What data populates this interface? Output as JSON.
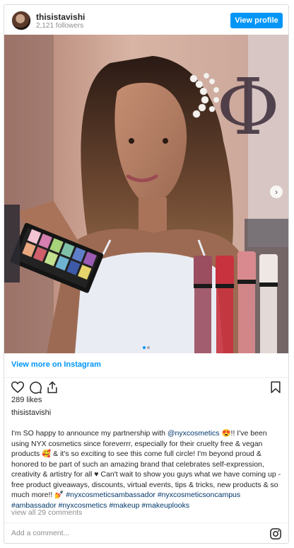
{
  "header": {
    "username": "thisistavishi",
    "followers": "2,121 followers",
    "view_profile_label": "View profile"
  },
  "media": {
    "next_arrow_glyph": "›",
    "carousel_dots": 2,
    "active_dot": 0,
    "dot_active_color": "#0095f6",
    "dot_inactive_color": "#a8a8a8",
    "palette_colors": [
      "#f4c4d3",
      "#d57fb0",
      "#a7d37a",
      "#7fc1a8",
      "#5f7fc8",
      "#9a5cb5",
      "#e8a77e",
      "#cf5f6b",
      "#c3e08e",
      "#6fb3d2",
      "#3d5aa8",
      "#e7d46a"
    ],
    "lip_products": [
      {
        "color": "#9a4e60",
        "name": "lip-gloss-mauve"
      },
      {
        "color": "#c8323e",
        "name": "lip-gloss-red-leopard"
      },
      {
        "color": "#d98a8e",
        "name": "butter-gloss-pink"
      },
      {
        "color": "#efe7e3",
        "name": "filler-lip-leopard"
      }
    ]
  },
  "view_more_label": "View more on Instagram",
  "actions": {
    "like_icon": "heart-icon",
    "comment_icon": "comment-icon",
    "share_icon": "share-icon",
    "save_icon": "bookmark-icon"
  },
  "likes": "289 likes",
  "caption": {
    "author": "thisistavishi",
    "text_1": "I'm SO happy to announce my partnership with ",
    "mention": "@nyxcosmetics",
    "text_2": " 😍!! I've been using NYX cosmetics since foreverrr, especially for their cruelty free & vegan products 🥰 & it's so exciting to see this come full circle! I'm beyond proud & honored to be part of such an amazing brand that celebrates self-expression, creativity & artistry for all ♥ Can't wait to show you guys what we have coming up - free product giveaways, discounts, virtual events, tips & tricks, new products & so much more!! 💅",
    "hashtags_1": "#nyxcosmeticsambassador #nyxcosmeticsoncampus #ambassador",
    "hashtags_2": "#nyxcosmetics #makeup #makeuplooks"
  },
  "view_comments_label": "view all 29 comments",
  "comment_placeholder": "Add a comment..."
}
